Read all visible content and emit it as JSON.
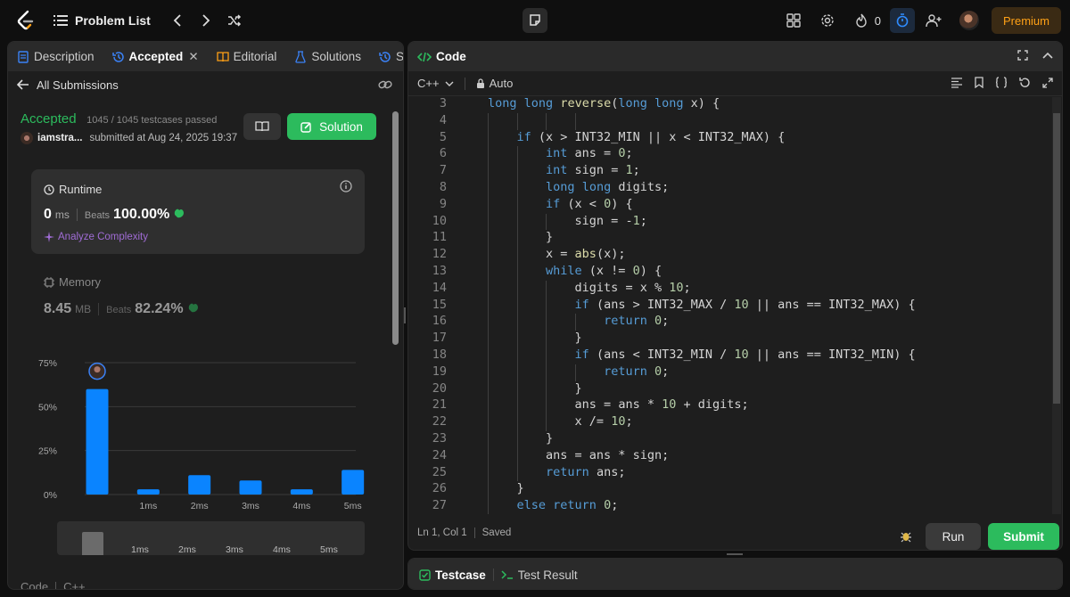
{
  "topbar": {
    "title": "Problem List",
    "fire_count": "0",
    "premium_label": "Premium"
  },
  "left_tabs": [
    {
      "label": "Description"
    },
    {
      "label": "Accepted"
    },
    {
      "label": "Editorial"
    },
    {
      "label": "Solutions"
    },
    {
      "label": "Su"
    }
  ],
  "back_label": "All Submissions",
  "submission": {
    "status": "Accepted",
    "testcases": "1045 / 1045 testcases passed",
    "user": "iamstra...",
    "submitted": "submitted at Aug 24, 2025 19:37",
    "solution_label": "Solution"
  },
  "runtime": {
    "title": "Runtime",
    "value": "0",
    "unit": "ms",
    "beats_label": "Beats",
    "beats_value": "100.00%",
    "analyze_label": "Analyze Complexity"
  },
  "memory": {
    "title": "Memory",
    "value": "8.45",
    "unit": "MB",
    "beats_label": "Beats",
    "beats_value": "82.24%"
  },
  "chart_data": {
    "type": "bar",
    "categories": [
      "",
      "1ms",
      "2ms",
      "3ms",
      "4ms",
      "5ms"
    ],
    "values": [
      60,
      3,
      11,
      8,
      3,
      14
    ],
    "ylim": [
      0,
      75
    ],
    "yticks": [
      "0%",
      "25%",
      "50%",
      "75%"
    ],
    "range_labels": [
      "1ms",
      "2ms",
      "3ms",
      "4ms",
      "5ms"
    ],
    "grid": true,
    "bar_color": "#0a84ff"
  },
  "left_bottom": {
    "code_label": "Code",
    "lang_label": "C++"
  },
  "code_panel": {
    "title": "Code",
    "language": "C++",
    "auto_label": "Auto",
    "cursor": "Ln 1, Col 1",
    "saved": "Saved",
    "run_label": "Run",
    "submit_label": "Submit"
  },
  "code_lines": [
    {
      "n": "3",
      "indent": 0,
      "t": "long long reverse(long long x) {"
    },
    {
      "n": "4",
      "indent": 0,
      "t": ""
    },
    {
      "n": "5",
      "indent": 1,
      "t": "if (x > INT32_MIN || x < INT32_MAX) {"
    },
    {
      "n": "6",
      "indent": 2,
      "t": "int ans = 0;"
    },
    {
      "n": "7",
      "indent": 2,
      "t": "int sign = 1;"
    },
    {
      "n": "8",
      "indent": 2,
      "t": "long long digits;"
    },
    {
      "n": "9",
      "indent": 2,
      "t": "if (x < 0) {"
    },
    {
      "n": "10",
      "indent": 3,
      "t": "sign = -1;"
    },
    {
      "n": "11",
      "indent": 2,
      "t": "}"
    },
    {
      "n": "12",
      "indent": 2,
      "t": "x = abs(x);"
    },
    {
      "n": "13",
      "indent": 2,
      "t": "while (x != 0) {"
    },
    {
      "n": "14",
      "indent": 3,
      "t": "digits = x % 10;"
    },
    {
      "n": "15",
      "indent": 3,
      "t": "if (ans > INT32_MAX / 10 || ans == INT32_MAX) {"
    },
    {
      "n": "16",
      "indent": 4,
      "t": "return 0;"
    },
    {
      "n": "17",
      "indent": 3,
      "t": "}"
    },
    {
      "n": "18",
      "indent": 3,
      "t": "if (ans < INT32_MIN / 10 || ans == INT32_MIN) {"
    },
    {
      "n": "19",
      "indent": 4,
      "t": "return 0;"
    },
    {
      "n": "20",
      "indent": 3,
      "t": "}"
    },
    {
      "n": "21",
      "indent": 3,
      "t": "ans = ans * 10 + digits;"
    },
    {
      "n": "22",
      "indent": 3,
      "t": "x /= 10;"
    },
    {
      "n": "23",
      "indent": 2,
      "t": "}"
    },
    {
      "n": "24",
      "indent": 2,
      "t": "ans = ans * sign;"
    },
    {
      "n": "25",
      "indent": 2,
      "t": "return ans;"
    },
    {
      "n": "26",
      "indent": 1,
      "t": "}"
    },
    {
      "n": "27",
      "indent": 1,
      "t": "else return 0;"
    }
  ],
  "test_panel": {
    "testcase_label": "Testcase",
    "result_label": "Test Result"
  }
}
